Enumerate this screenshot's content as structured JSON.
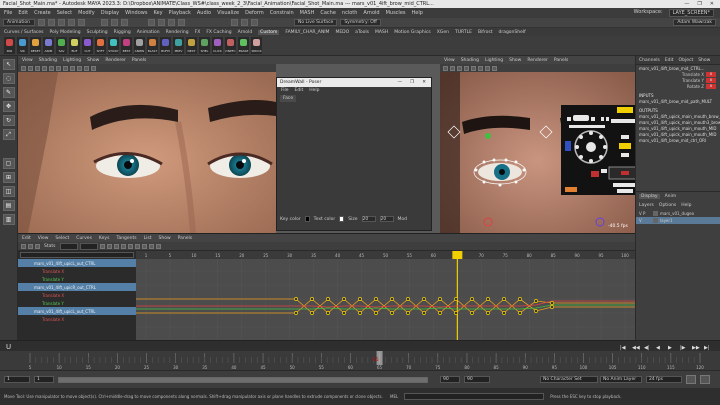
{
  "window": {
    "title": "Facial_Shot_Main.ma* - Autodesk MAYA 2023.3: D:\\Dropbox\\ANIMATE\\Class_WS#\\class_week_2_3\\Facial_Animation\\Facial_Shot_Main.ma --- mars_v01_4ift_brow_mid_CTRL...",
    "controls": [
      "—",
      "❐",
      "✕"
    ]
  },
  "menubar": {
    "items": [
      "File",
      "Edit",
      "Create",
      "Select",
      "Modify",
      "Display",
      "Windows",
      "Key",
      "Playback",
      "Audio",
      "Visualize",
      "Deform",
      "Constrain",
      "MASH",
      "Cache",
      "ncloth",
      "Arnold",
      "Muscles",
      "Help"
    ],
    "workspace_label": "Workspace:",
    "workspace_value": "LAYE_SCREEN*"
  },
  "statusline": {
    "mode": "Animation",
    "live_surface": "No Live Surface",
    "symmetry": "Symmetry: Off",
    "user": "Adam Wawrzak"
  },
  "shelf": {
    "tabs": [
      "Curves / Surfaces",
      "Poly Modeling",
      "Sculpting",
      "Rigging",
      "Animation",
      "Rendering",
      "FX",
      "FX Caching",
      "Arnold",
      "Custom",
      "FAMILY_CHAR_ANIM",
      "MEDO",
      "aTools",
      "MASH",
      "Motion Graphics",
      "XGen",
      "TURTLE",
      "Bifrost",
      "dragonShelf"
    ],
    "active_tab": "Custom",
    "buttons": [
      {
        "label": "PAR",
        "color": "#d04a4a"
      },
      {
        "label": "SIK",
        "color": "#4a9ad0"
      },
      {
        "label": "RESET",
        "color": "#e0a040"
      },
      {
        "label": "ANIM",
        "color": "#7a7ad0"
      },
      {
        "label": "SAV",
        "color": "#50b050"
      },
      {
        "label": "BUF",
        "color": "#d0d060"
      },
      {
        "label": "CUT",
        "color": "#8a5ad0"
      },
      {
        "label": "SHFT",
        "color": "#e07040"
      },
      {
        "label": "STICKY",
        "color": "#40c0c0"
      },
      {
        "label": "BEST",
        "color": "#c04080"
      },
      {
        "label": "ANIMS",
        "color": "#a0a0a0"
      },
      {
        "label": "BLAST",
        "color": "#d08040"
      },
      {
        "label": "BUFPI",
        "color": "#6060c0"
      },
      {
        "label": "PREV",
        "color": "#40a0a0"
      },
      {
        "label": "NEXT",
        "color": "#c0a040"
      },
      {
        "label": "SHEL",
        "color": "#60a060"
      },
      {
        "label": "CLICK",
        "color": "#a060c0"
      },
      {
        "label": "DNPFC",
        "color": "#c06060"
      },
      {
        "label": "ERASE",
        "color": "#60c060"
      },
      {
        "label": "SPDCK",
        "color": "#d0a0a0"
      }
    ]
  },
  "viewports": {
    "menu": [
      "View",
      "Shading",
      "Lighting",
      "Show",
      "Renderer",
      "Panels"
    ],
    "right_hud": "-40.5 fps",
    "middle_hud": "-40.5 fps"
  },
  "poser": {
    "title": "DreamWall - Poser",
    "menu": [
      "File",
      "Edit",
      "Help"
    ],
    "tab": "Face",
    "mirror_label": "Mirror",
    "bottom": {
      "key_color": "Key color",
      "text_color": "Text color",
      "size_label": "Size",
      "size_value": "20",
      "size2": "20",
      "mode": "Mod"
    }
  },
  "channelbox": {
    "tabs": [
      "Channels",
      "Edit",
      "Object",
      "Show"
    ],
    "object": "mars_v01_4ift_brow_mid_CTRL...",
    "attributes": [
      {
        "name": "Translate X",
        "value": "0"
      },
      {
        "name": "Translate Y",
        "value": "0"
      },
      {
        "name": "Rotate Z",
        "value": "0"
      }
    ],
    "inputs_label": "INPUTS",
    "inputs": [
      "mars_v01_4ift_brow_mid_path_MULT"
    ],
    "outputs_label": "OUTPUTS",
    "outputs": [
      "mars_v01_4ift_upick_main_mouth_brow_R",
      "mars_v01_4ift_upick_main_mouth3_brow_L",
      "mars_v01_4ift_upick_main_mouth_MID",
      "mars_v01_4ift_upick_main_mouth_MID",
      "mars_v01_4ift_brow_mid_ctrl_ORI"
    ]
  },
  "layers": {
    "tabs": [
      "Display",
      "Anim"
    ],
    "menu": [
      "Layers",
      "Options",
      "Help"
    ],
    "rows": [
      {
        "flags": "V P",
        "name": "mars_v01_dugeo",
        "selected": false
      },
      {
        "flags": "V",
        "name": "layer1",
        "selected": true
      }
    ]
  },
  "grapheditor": {
    "menu": [
      "Edit",
      "View",
      "Select",
      "Curves",
      "Keys",
      "Tangents",
      "List",
      "Show",
      "Panels"
    ],
    "stats_label": "Stats",
    "outliner": [
      {
        "text": "mars_v01_4ift_upicL_out_CTRL",
        "type": "sel"
      },
      {
        "text": "Translate X",
        "type": "sub"
      },
      {
        "text": "Translate Y",
        "type": "subg"
      },
      {
        "text": "mars_v01_4ift_upicR_out_CTRL",
        "type": "sel"
      },
      {
        "text": "Translate X",
        "type": "sub"
      },
      {
        "text": "Translate Y",
        "type": "subg"
      },
      {
        "text": "mars_v01_4ift_upicL_out_CTRL",
        "type": "sel"
      },
      {
        "text": "Translate X",
        "type": "sub"
      }
    ],
    "frame_numbers": [
      "1",
      "5",
      "10",
      "15",
      "20",
      "25",
      "30",
      "35",
      "40",
      "45",
      "50",
      "55",
      "60",
      "65",
      "70",
      "75",
      "80",
      "85",
      "90",
      "95",
      "100"
    ],
    "current_frame": "65"
  },
  "timeslider": {
    "ticks": [
      "5",
      "10",
      "15",
      "20",
      "25",
      "30",
      "35",
      "40",
      "45",
      "50",
      "55",
      "60",
      "65",
      "70",
      "75",
      "80",
      "85",
      "90",
      "95",
      "100",
      "105",
      "110",
      "115",
      "120"
    ],
    "current": "65"
  },
  "rangebar": {
    "start": "1",
    "inner_start": "1",
    "inner_end": "90",
    "end": "90",
    "character_set": "No Character Set",
    "anim_layer": "No Anim Layer",
    "fps": "24 fps"
  },
  "commandline": {
    "lang": "MEL",
    "help": "Move Tool: Use manipulator to move object(s). Ctrl+middle-drag to move components along normals. Shift+drag manipulator axis or plane handles to extrude components or clone objects. Ctrl+Shift+drag to con",
    "escape": "Press the ESC key to stop playback."
  },
  "colors": {
    "accent_yellow": "#f0d000",
    "curve_red": "#e04040",
    "curve_green": "#40c040",
    "curve_orange": "#f0a020"
  }
}
